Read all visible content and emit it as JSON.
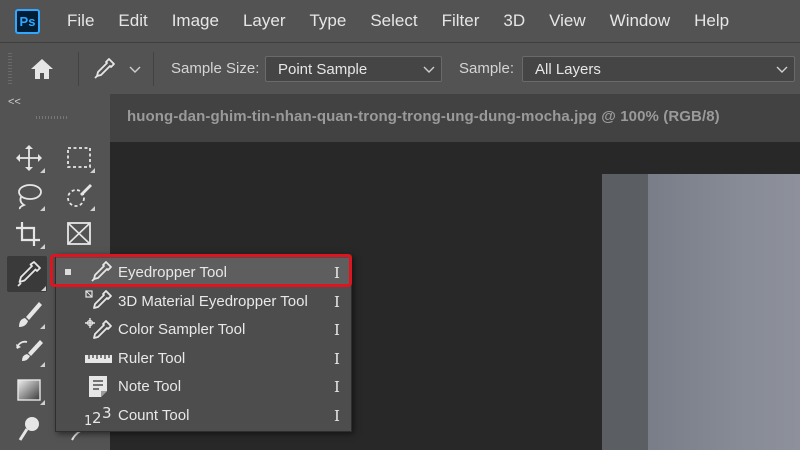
{
  "app": {
    "logo_text": "Ps"
  },
  "menu": [
    "File",
    "Edit",
    "Image",
    "Layer",
    "Type",
    "Select",
    "Filter",
    "3D",
    "View",
    "Window",
    "Help"
  ],
  "options_bar": {
    "sample_size_label": "Sample Size:",
    "sample_size_value": "Point Sample",
    "sample_label": "Sample:",
    "sample_value": "All Layers"
  },
  "toolbar": {
    "collapse_glyph": "<<"
  },
  "document": {
    "tab_title": "huong-dan-ghim-tin-nhan-quan-trong-trong-ung-dung-mocha.jpg @ 100% (RGB/8)"
  },
  "flyout": {
    "items": [
      {
        "label": "Eyedropper Tool",
        "shortcut": "I",
        "icon": "eyedropper-icon",
        "selected": true
      },
      {
        "label": "3D Material Eyedropper Tool",
        "shortcut": "I",
        "icon": "3d-material-eyedropper-icon",
        "selected": false
      },
      {
        "label": "Color Sampler Tool",
        "shortcut": "I",
        "icon": "color-sampler-icon",
        "selected": false
      },
      {
        "label": "Ruler Tool",
        "shortcut": "I",
        "icon": "ruler-icon",
        "selected": false
      },
      {
        "label": "Note Tool",
        "shortcut": "I",
        "icon": "note-icon",
        "selected": false
      },
      {
        "label": "Count Tool",
        "shortcut": "I",
        "icon": "count-icon",
        "selected": false
      }
    ]
  },
  "colors": {
    "highlight": "#e0141e",
    "panel": "#535353",
    "background": "#282828",
    "ps_blue": "#31a8ff"
  }
}
